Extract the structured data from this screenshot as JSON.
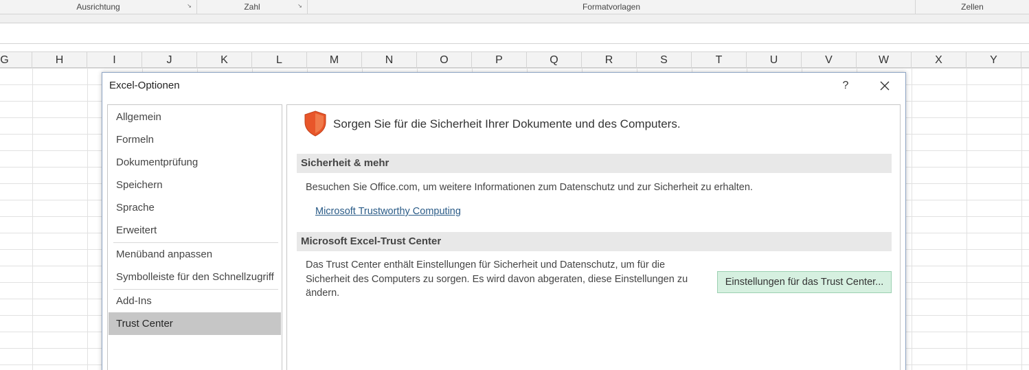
{
  "ribbon": {
    "groups": [
      {
        "label": "Ausrichtung",
        "launcher": "↘"
      },
      {
        "label": "Zahl",
        "launcher": "↘"
      },
      {
        "label": "Formatvorlagen"
      },
      {
        "label": "Zellen"
      }
    ]
  },
  "sheet": {
    "columns": [
      "G",
      "H",
      "I",
      "J",
      "K",
      "L",
      "M",
      "N",
      "O",
      "P",
      "Q",
      "R",
      "S",
      "T",
      "U",
      "V",
      "W",
      "X",
      "Y"
    ]
  },
  "dialog": {
    "title": "Excel-Optionen",
    "help": "?",
    "close": "✕",
    "nav": [
      {
        "label": "Allgemein"
      },
      {
        "label": "Formeln"
      },
      {
        "label": "Dokumentprüfung"
      },
      {
        "label": "Speichern"
      },
      {
        "label": "Sprache"
      },
      {
        "label": "Erweitert"
      },
      {
        "label": "Menüband anpassen"
      },
      {
        "label": "Symbolleiste für den Schnellzugriff"
      },
      {
        "label": "Add-Ins"
      },
      {
        "label": "Trust Center",
        "active": true
      }
    ],
    "headline": "Sorgen Sie für die Sicherheit Ihrer Dokumente und des Computers.",
    "icons": {
      "shield": "shield-icon"
    },
    "colors": {
      "shield": "#e8562a",
      "button_bg": "#d6f0e0",
      "active_nav": "#c6c6c6",
      "link": "#2a5b87"
    },
    "sections": {
      "security": {
        "header": "Sicherheit & mehr",
        "text": "Besuchen Sie Office.com, um weitere Informationen zum Datenschutz und zur Sicherheit zu erhalten.",
        "link": "Microsoft Trustworthy Computing"
      },
      "trust_center": {
        "header": "Microsoft Excel-Trust Center",
        "text_lines": [
          "Das Trust Center enthält Einstellungen für Sicherheit und Datenschutz, um für die",
          "Sicherheit des Computers zu sorgen. Es wird davon abgeraten, diese Einstellungen zu",
          "ändern."
        ],
        "button": "Einstellungen für das Trust Center..."
      }
    }
  }
}
